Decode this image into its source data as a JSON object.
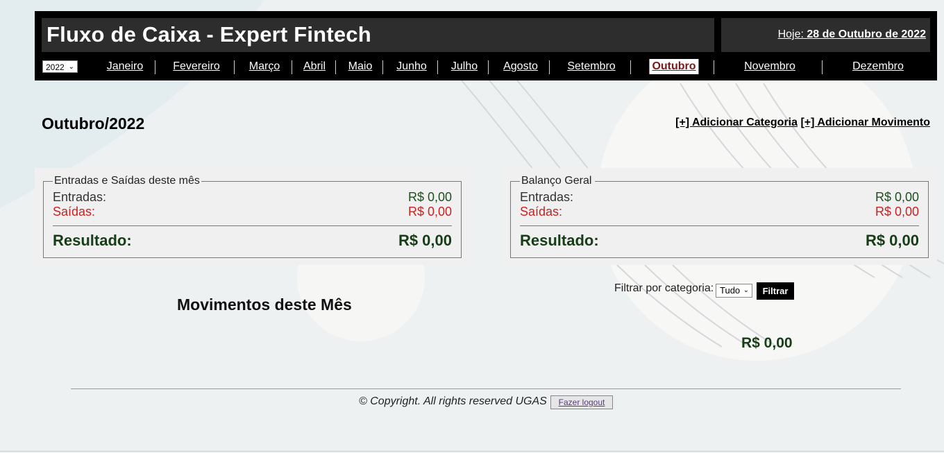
{
  "header": {
    "title": "Fluxo de Caixa - Expert Fintech",
    "today_label": "Hoje:",
    "today_value": "28 de Outubro de 2022",
    "year_value": "2022",
    "months": [
      "Janeiro",
      "Fevereiro",
      "Março",
      "Abril",
      "Maio",
      "Junho",
      "Julho",
      "Agosto",
      "Setembro",
      "Outubro",
      "Novembro",
      "Dezembro"
    ],
    "active_month": "Outubro"
  },
  "page": {
    "title": "Outubro/2022",
    "add_category": "[+] Adicionar Categoria",
    "add_movement": "[+] Adicionar Movimento"
  },
  "month_summary": {
    "legend": "Entradas e Saídas deste mês",
    "in_label": "Entradas:",
    "in_value": "R$ 0,00",
    "out_label": "Saídas:",
    "out_value": "R$ 0,00",
    "result_label": "Resultado:",
    "result_value": "R$ 0,00"
  },
  "general_summary": {
    "legend": "Balanço Geral",
    "in_label": "Entradas:",
    "in_value": "R$ 0,00",
    "out_label": "Saídas:",
    "out_value": "R$ 0,00",
    "result_label": "Resultado:",
    "result_value": "R$ 0,00"
  },
  "movements": {
    "title": "Movimentos deste Mês",
    "filter_label": "Filtrar por categoria:",
    "filter_value": "Tudo",
    "filter_button": "Filtrar",
    "total": "R$ 0,00"
  },
  "footer": {
    "copyright": "© Copyright. All rights reserved UGAS",
    "logout": "Fazer logout"
  },
  "colors": {
    "header_bg": "#000000",
    "title_bg": "#2d2d2d",
    "active_month_text": "#7a1a1a",
    "out_text": "#cc1f1f",
    "result_text": "#173d17"
  }
}
